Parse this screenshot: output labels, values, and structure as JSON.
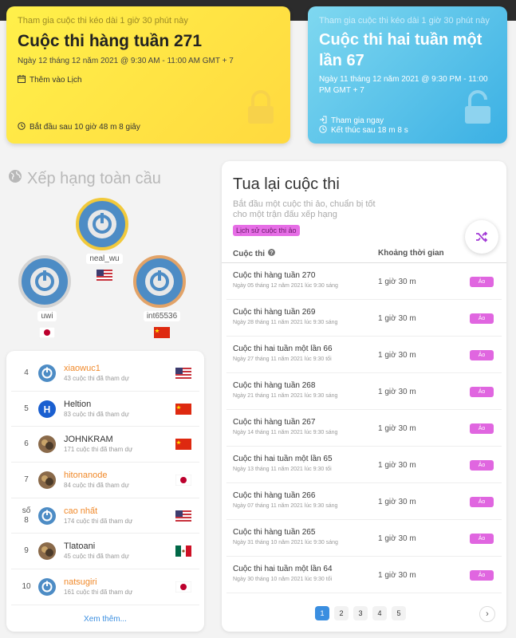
{
  "weekly_card": {
    "duration": "Tham gia cuộc thi kéo dài 1 giờ 30 phút này",
    "title": "Cuộc thi hàng tuần 271",
    "date": "Ngày 12 tháng 12 năm 2021 @ 9:30 AM - 11:00 AM GMT + 7",
    "add_calendar": "Thêm vào Lịch",
    "countdown": "Bắt đầu sau 10 giờ 48 m 8 giây"
  },
  "biweekly_card": {
    "duration": "Tham gia cuộc thi kéo dài 1 giờ 30 phút này",
    "title": "Cuộc thi hai tuần một lần 67",
    "date": "Ngày 11 tháng 12 năm 2021 @ 9:30 PM - 11:00 PM GMT + 7",
    "join": "Tham gia ngay",
    "countdown": "Kết thúc sau 18 m 8 s"
  },
  "global_ranking": {
    "title": "Xếp hạng toàn cầu",
    "podium": [
      {
        "name": "neal_wu",
        "flag": "us"
      },
      {
        "name": "uwi",
        "flag": "jp"
      },
      {
        "name": "int65536",
        "flag": "cn"
      }
    ],
    "list": [
      {
        "rank": "4",
        "name": "xiaowuc1",
        "sub": "43 cuộc thi đã tham dự",
        "flag": "us",
        "orange": true,
        "avatar": "power-icon"
      },
      {
        "rank": "5",
        "name": "Heltion",
        "sub": "83 cuộc thi đã tham dự",
        "flag": "cn",
        "orange": false,
        "avatar": "h-icon"
      },
      {
        "rank": "6",
        "name": "JOHNKRAM",
        "sub": "171 cuộc thi đã tham dự",
        "flag": "cn",
        "orange": false,
        "avatar": "photo"
      },
      {
        "rank": "7",
        "name": "hitonanode",
        "sub": "84 cuộc thi đã tham dự",
        "flag": "jp",
        "orange": true,
        "avatar": "photo"
      },
      {
        "rank": "số 8",
        "name": "cao nhất",
        "sub": "174 cuộc thi đã tham dự",
        "flag": "us",
        "orange": true,
        "avatar": "power-icon"
      },
      {
        "rank": "9",
        "name": "Tlatoani",
        "sub": "45 cuộc thi đã tham dự",
        "flag": "mx",
        "orange": false,
        "avatar": "photo"
      },
      {
        "rank": "10",
        "name": "natsugiri",
        "sub": "161 cuộc thi đã tham dự",
        "flag": "jp",
        "orange": true,
        "avatar": "power-icon"
      }
    ],
    "more": "Xem thêm..."
  },
  "replay": {
    "title": "Tua lại cuộc thi",
    "subtitle": "Bắt đầu một cuộc thi ảo, chuẩn bị tốt cho một trận đấu xếp hạng",
    "history_button": "Lịch sử cuộc thi ảo",
    "col_contest": "Cuộc thi",
    "col_duration": "Khoảng thời gian",
    "rows": [
      {
        "name": "Cuộc thi hàng tuần 270",
        "date": "Ngày 05 tháng 12 năm 2021 lúc 9:30 sáng",
        "duration": "1 giờ 30 m",
        "action": "Ảo"
      },
      {
        "name": "Cuộc thi hàng tuần 269",
        "date": "Ngày 28 tháng 11 năm 2021 lúc 9:30 sáng",
        "duration": "1 giờ 30 m",
        "action": "Ảo"
      },
      {
        "name": "Cuộc thi hai tuần một lần 66",
        "date": "Ngày 27 tháng 11 năm 2021 lúc 9:30 tối",
        "duration": "1 giờ 30 m",
        "action": "Ảo"
      },
      {
        "name": "Cuộc thi hàng tuần 268",
        "date": "Ngày 21 tháng 11 năm 2021 lúc 9:30 sáng",
        "duration": "1 giờ 30 m",
        "action": "Ảo"
      },
      {
        "name": "Cuộc thi hàng tuần 267",
        "date": "Ngày 14 tháng 11 năm 2021 lúc 9:30 sáng",
        "duration": "1 giờ 30 m",
        "action": "Ảo"
      },
      {
        "name": "Cuộc thi hai tuần một lần 65",
        "date": "Ngày 13 tháng 11 năm 2021 lúc 9:30 tối",
        "duration": "1 giờ 30 m",
        "action": "Ảo"
      },
      {
        "name": "Cuộc thi hàng tuần 266",
        "date": "Ngày 07 tháng 11 năm 2021 lúc 9:30 sáng",
        "duration": "1 giờ 30 m",
        "action": "Ảo"
      },
      {
        "name": "Cuộc thi hàng tuần 265",
        "date": "Ngày 31 tháng 10 năm 2021 lúc 9:30 sáng",
        "duration": "1 giờ 30 m",
        "action": "Ảo"
      },
      {
        "name": "Cuộc thi hai tuần một lần 64",
        "date": "Ngày 30 tháng 10 năm 2021 lúc 9:30 tối",
        "duration": "1 giờ 30 m",
        "action": "Ảo"
      }
    ],
    "pages": [
      "1",
      "2",
      "3",
      "4",
      "5"
    ],
    "active_page": "1",
    "next": "›"
  },
  "colors": {
    "accent_blue": "#3a8ee0",
    "virtual_pink": "#e066e0",
    "weekly_yellow": "#ffe444",
    "biweekly_blue": "#4cc0ec"
  }
}
